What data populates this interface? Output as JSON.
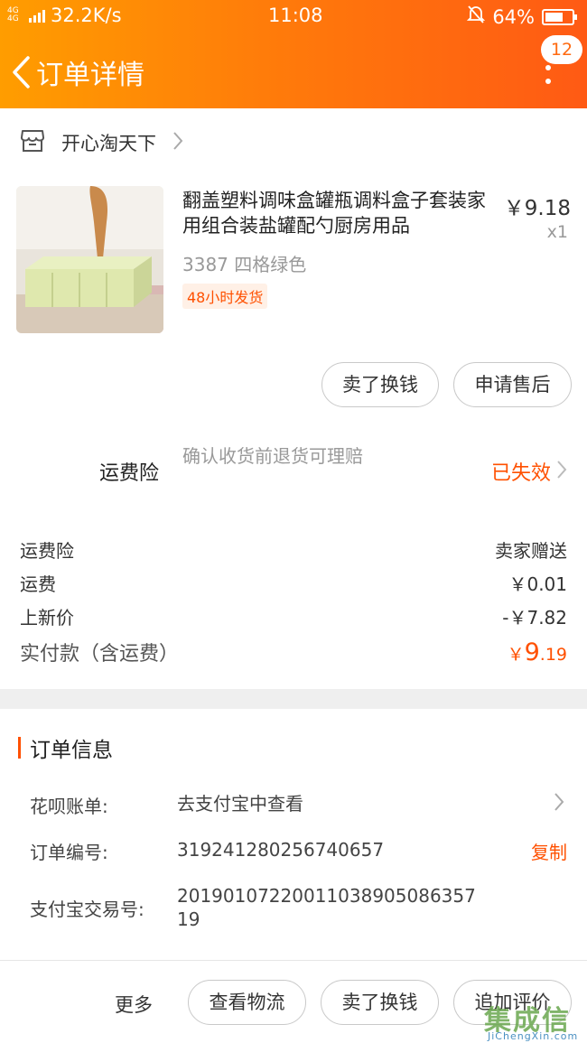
{
  "status_bar": {
    "network": "4G 4G",
    "speed": "32.2K/s",
    "time": "11:08",
    "battery": "64%"
  },
  "header": {
    "title": "订单详情",
    "badge_count": "12"
  },
  "shop": {
    "name": "开心淘天下"
  },
  "product": {
    "title": "翻盖塑料调味盒罐瓶调料盒子套装家用组合装盐罐配勺厨房用品",
    "price": "￥9.18",
    "qty": "x1",
    "sku": "3387 四格绿色",
    "ship_tag": "48小时发货"
  },
  "item_actions": {
    "sell_label": "卖了换钱",
    "aftersale_label": "申请售后"
  },
  "insurance": {
    "label": "运费险",
    "desc": "确认收货前退货可理赔",
    "status": "已失效"
  },
  "fees": [
    {
      "label": "运费险",
      "value": "卖家赠送"
    },
    {
      "label": "运费",
      "value": "￥0.01"
    },
    {
      "label": "上新价",
      "value": "-￥7.82"
    }
  ],
  "total": {
    "label": "实付款（含运费）",
    "currency": "￥",
    "int_part": "9",
    "dec_part": ".19"
  },
  "order_info": {
    "title": "订单信息",
    "huabei_label": "花呗账单:",
    "huabei_value": "去支付宝中查看",
    "order_no_label": "订单编号:",
    "order_no": "319241280256740657",
    "copy_label": "复制",
    "alipay_label": "支付宝交易号:",
    "alipay_no": "20190107220011038905086357 19"
  },
  "bottom_bar": {
    "more_label": "更多",
    "logistics_label": "查看物流",
    "sell_label": "卖了换钱",
    "review_label": "追加评价"
  },
  "watermark": {
    "logo_text": "集成信",
    "url": "JiChengXin.com"
  },
  "colors": {
    "accent": "#ff5000",
    "header_start": "#ff9d00",
    "header_end": "#ff5a14"
  },
  "icons": [
    "back-arrow-icon",
    "more-dots-icon",
    "store-icon",
    "chevron-right-icon",
    "signal-icon",
    "mute-bell-icon",
    "battery-icon"
  ]
}
